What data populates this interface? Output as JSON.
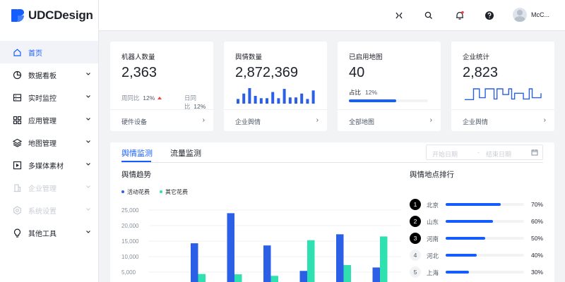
{
  "app": {
    "logo_text": "UDCDesign"
  },
  "header": {
    "user_name": "McC..."
  },
  "sidebar": {
    "items": [
      {
        "label": "首页",
        "icon": "home-icon",
        "active": true,
        "disabled": false,
        "has_children": false
      },
      {
        "label": "数据看板",
        "icon": "pie-chart-icon",
        "active": false,
        "disabled": false,
        "has_children": true
      },
      {
        "label": "实时监控",
        "icon": "monitor-icon",
        "active": false,
        "disabled": false,
        "has_children": true
      },
      {
        "label": "应用管理",
        "icon": "apps-grid-icon",
        "active": false,
        "disabled": false,
        "has_children": true
      },
      {
        "label": "地图管理",
        "icon": "layers-icon",
        "active": false,
        "disabled": false,
        "has_children": true
      },
      {
        "label": "多媒体素材",
        "icon": "play-icon",
        "active": false,
        "disabled": false,
        "has_children": true
      },
      {
        "label": "企业管理",
        "icon": "building-icon",
        "active": false,
        "disabled": true,
        "has_children": true
      },
      {
        "label": "系统设置",
        "icon": "settings-icon",
        "active": false,
        "disabled": true,
        "has_children": true
      },
      {
        "label": "其他工具",
        "icon": "bulb-icon",
        "active": false,
        "disabled": false,
        "has_children": true
      }
    ]
  },
  "cards": {
    "robots": {
      "title": "机器人数量",
      "value": "2,363",
      "week_label": "周同比",
      "week_value": "12%",
      "day_label": "日同比",
      "day_value": "12%",
      "footer": "硬件设备"
    },
    "opinion": {
      "title": "舆情数量",
      "value": "2,872,369",
      "footer": "企业舆情",
      "bars": [
        0.3,
        0.65,
        1.0,
        0.5,
        0.35,
        0.35,
        0.75,
        0.35,
        0.95,
        0.4,
        0.4,
        0.65,
        0.3,
        0.85
      ]
    },
    "maps": {
      "title": "已启用地图",
      "value": "40",
      "ratio_label": "占比",
      "ratio_value": "12%",
      "ratio": 0.6,
      "footer": "全部地图"
    },
    "company": {
      "title": "企业统计",
      "value": "2,823",
      "footer": "企业舆情",
      "steps": [
        0.15,
        0.15,
        0.15,
        1.0,
        1.0,
        0.3,
        0.3,
        1.0,
        1.0,
        1.0,
        0.2,
        1.0,
        1.0,
        0.55,
        0.55,
        1.0,
        0.2,
        0.65,
        0.65,
        0.65,
        0.2,
        0.2,
        1.0,
        0.3,
        0.3,
        0.3,
        0.65
      ]
    }
  },
  "panel": {
    "tabs": [
      {
        "label": "舆情监测",
        "active": true
      },
      {
        "label": "流量监测",
        "active": false
      }
    ],
    "date_start_placeholder": "开始日期",
    "date_separator": "-",
    "date_end_placeholder": "结束日期",
    "trend_title": "舆情趋势",
    "ranking_title": "舆情地点排行",
    "ranking": [
      {
        "rank": "1",
        "name": "北京",
        "pct": "70%",
        "value": 0.7
      },
      {
        "rank": "2",
        "name": "山东",
        "pct": "60%",
        "value": 0.6
      },
      {
        "rank": "3",
        "name": "河南",
        "pct": "50%",
        "value": 0.5
      },
      {
        "rank": "4",
        "name": "河北",
        "pct": "40%",
        "value": 0.4
      },
      {
        "rank": "5",
        "name": "上海",
        "pct": "30%",
        "value": 0.3
      }
    ]
  },
  "chart_data": {
    "type": "bar",
    "title": "舆情趋势",
    "xlabel": "",
    "ylabel": "",
    "ylim": [
      0,
      25000
    ],
    "yticks": [
      "25,000",
      "20,000",
      "15,000",
      "10,000",
      "5,000"
    ],
    "ytick_values": [
      25000,
      20000,
      15000,
      10000,
      5000
    ],
    "categories": [
      "",
      "",
      "",
      "",
      "",
      ""
    ],
    "series": [
      {
        "name": "活动花费",
        "color": "#2b5fe6",
        "values": [
          14300,
          24000,
          13600,
          5400,
          17200,
          6500
        ]
      },
      {
        "name": "其它花费",
        "color": "#2fe0b0",
        "values": [
          4400,
          4300,
          3800,
          15300,
          7300,
          16500
        ]
      }
    ],
    "legend": "top-left",
    "grid": true
  }
}
